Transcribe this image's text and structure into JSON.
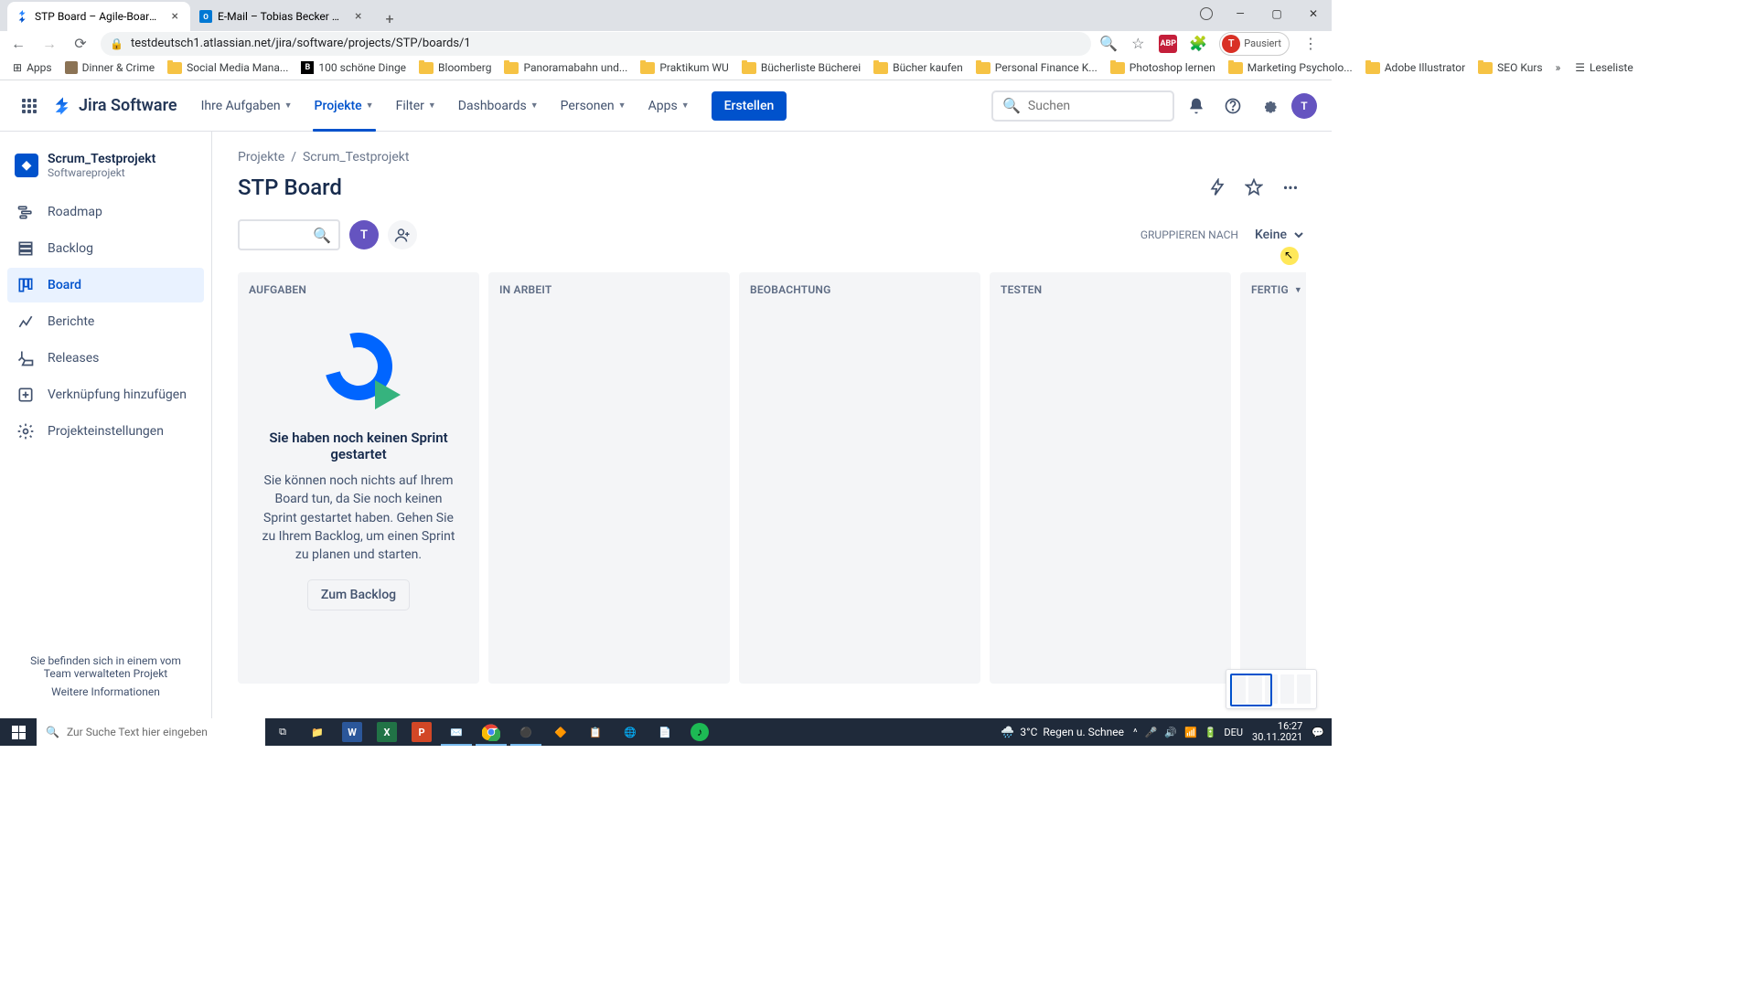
{
  "browser": {
    "tabs": [
      {
        "title": "STP Board – Agile-Board - Jira",
        "active": true,
        "favicon": "jira"
      },
      {
        "title": "E-Mail – Tobias Becker – Outlook",
        "active": false,
        "favicon": "outlook"
      }
    ],
    "url": "testdeutsch1.atlassian.net/jira/software/projects/STP/boards/1",
    "profile_label": "Pausiert",
    "profile_initial": "T",
    "bookmarks": [
      {
        "label": "Apps",
        "icon": "grid"
      },
      {
        "label": "Dinner & Crime",
        "icon": "jh"
      },
      {
        "label": "Social Media Mana...",
        "icon": "folder"
      },
      {
        "label": "100 schöne Dinge",
        "icon": "b"
      },
      {
        "label": "Bloomberg",
        "icon": "folder"
      },
      {
        "label": "Panoramabahn und...",
        "icon": "folder"
      },
      {
        "label": "Praktikum WU",
        "icon": "folder"
      },
      {
        "label": "Bücherliste Bücherei",
        "icon": "folder"
      },
      {
        "label": "Bücher kaufen",
        "icon": "folder"
      },
      {
        "label": "Personal Finance K...",
        "icon": "folder"
      },
      {
        "label": "Photoshop lernen",
        "icon": "folder"
      },
      {
        "label": "Marketing Psycholo...",
        "icon": "folder"
      },
      {
        "label": "Adobe Illustrator",
        "icon": "folder"
      },
      {
        "label": "SEO Kurs",
        "icon": "folder"
      }
    ],
    "reading_list": "Leseliste"
  },
  "jira_header": {
    "logo": "Jira Software",
    "nav": [
      {
        "label": "Ihre Aufgaben",
        "dropdown": true,
        "active": false
      },
      {
        "label": "Projekte",
        "dropdown": true,
        "active": true
      },
      {
        "label": "Filter",
        "dropdown": true,
        "active": false
      },
      {
        "label": "Dashboards",
        "dropdown": true,
        "active": false
      },
      {
        "label": "Personen",
        "dropdown": true,
        "active": false
      },
      {
        "label": "Apps",
        "dropdown": true,
        "active": false
      }
    ],
    "create_label": "Erstellen",
    "search_placeholder": "Suchen",
    "avatar_initial": "T"
  },
  "sidebar": {
    "project": {
      "name": "Scrum_Testprojekt",
      "type": "Softwareprojekt"
    },
    "items": [
      {
        "label": "Roadmap",
        "icon": "roadmap",
        "active": false
      },
      {
        "label": "Backlog",
        "icon": "backlog",
        "active": false
      },
      {
        "label": "Board",
        "icon": "board",
        "active": true
      },
      {
        "label": "Berichte",
        "icon": "reports",
        "active": false
      },
      {
        "label": "Releases",
        "icon": "releases",
        "active": false
      },
      {
        "label": "Verknüpfung hinzufügen",
        "icon": "link",
        "active": false
      },
      {
        "label": "Projekteinstellungen",
        "icon": "gear",
        "active": false
      }
    ],
    "footer_text": "Sie befinden sich in einem vom Team verwalteten Projekt",
    "footer_link": "Weitere Informationen"
  },
  "content": {
    "breadcrumb": [
      "Projekte",
      "Scrum_Testprojekt"
    ],
    "title": "STP Board",
    "avatar_initial": "T",
    "group_label": "GRUPPIEREN NACH",
    "group_value": "Keine",
    "columns": [
      {
        "name": "AUFGABEN"
      },
      {
        "name": "IN ARBEIT"
      },
      {
        "name": "BEOBACHTUNG"
      },
      {
        "name": "TESTEN"
      },
      {
        "name": "FERTIG",
        "dropdown": true
      }
    ],
    "empty_state": {
      "title": "Sie haben noch keinen Sprint gestartet",
      "text": "Sie können noch nichts auf Ihrem Board tun, da Sie noch keinen Sprint gestartet haben. Gehen Sie zu Ihrem Backlog, um einen Sprint zu planen und starten.",
      "button": "Zum Backlog"
    }
  },
  "taskbar": {
    "search_placeholder": "Zur Suche Text hier eingeben",
    "weather_temp": "3°C",
    "weather_text": "Regen u. Schnee",
    "lang": "DEU",
    "time": "16:27",
    "date": "30.11.2021"
  }
}
